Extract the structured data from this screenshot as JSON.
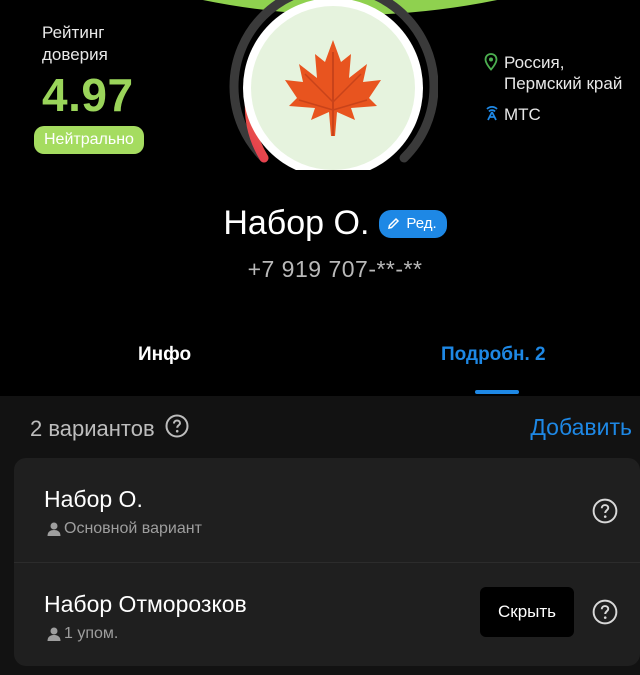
{
  "rating": {
    "label": "Рейтинг доверия",
    "value": "4.97",
    "badge": "Нейтрально",
    "gauge_fraction": 0.6
  },
  "location": {
    "region": "Россия, Пермский край",
    "carrier": "МТС"
  },
  "contact": {
    "name": "Набор О.",
    "edit_label": "Ред.",
    "phone": "+7 919 707-**-**"
  },
  "tabs": [
    {
      "label": "Инфо",
      "active": false
    },
    {
      "label": "Подробн. 2",
      "active": true
    }
  ],
  "variants": {
    "count_label": "2 вариантов",
    "add_label": "Добавить",
    "items": [
      {
        "title": "Набор О.",
        "subtitle": "Основной вариант"
      },
      {
        "title": "Набор Отморозков",
        "subtitle": "1 упом.",
        "action_label": "Скрыть"
      }
    ]
  },
  "colors": {
    "accent": "#1e88e5",
    "rating_green": "#9ad45a",
    "badge_green": "#a5dc60",
    "avatar_bg": "#e6f3de",
    "leaf": "#e8541f"
  },
  "icons": {
    "location": "location-pin-icon",
    "carrier": "signal-tower-icon",
    "edit": "pencil-icon",
    "help": "question-circle-icon",
    "person": "person-icon",
    "avatar": "maple-leaf-icon"
  }
}
